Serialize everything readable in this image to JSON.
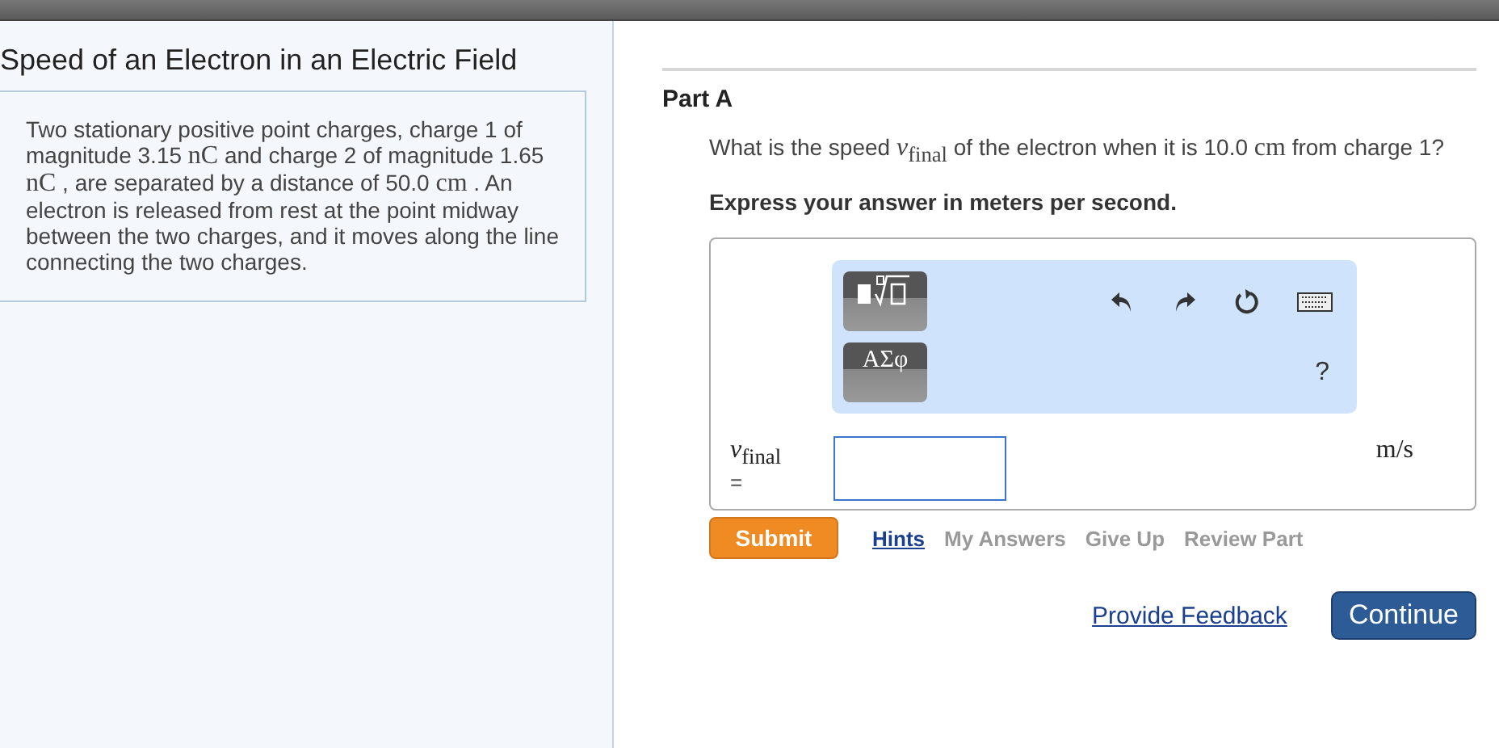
{
  "problem": {
    "title": "Speed of an Electron in an Electric Field",
    "parts": [
      {
        "kind": "text",
        "text": "Two stationary positive point charges, charge 1 of magnitude 3.15 "
      },
      {
        "kind": "math",
        "text": "nC"
      },
      {
        "kind": "text",
        "text": " and charge 2 of magnitude 1.65 "
      },
      {
        "kind": "math",
        "text": "nC"
      },
      {
        "kind": "text",
        "text": " , are separated by a distance of 50.0 "
      },
      {
        "kind": "math",
        "text": "cm"
      },
      {
        "kind": "text",
        "text": " . An electron is released from rest at the point midway between the two charges, and it moves along the line connecting the two charges."
      }
    ]
  },
  "part": {
    "title": "Part A",
    "question": [
      {
        "kind": "text",
        "text": "What is the speed "
      },
      {
        "kind": "math",
        "text": "*v*$_{final}$"
      },
      {
        "kind": "text",
        "text": "  of the electron when it is 10.0 "
      },
      {
        "kind": "math",
        "text": "cm"
      },
      {
        "kind": "text",
        "text": " from charge 1?"
      }
    ],
    "instruction": "Express your answer in meters per second.",
    "greek_button": "ΑΣφ",
    "help": "?",
    "answer_label": "*v*$_{final}$",
    "equals": "=",
    "unit": "m/s",
    "submit": "Submit",
    "links": [
      {
        "label": "Hints",
        "disabled": false
      },
      {
        "label": "My Answers",
        "disabled": true
      },
      {
        "label": "Give Up",
        "disabled": true
      },
      {
        "label": "Review Part",
        "disabled": true
      }
    ],
    "feedback": "Provide Feedback",
    "continue": "Continue"
  }
}
